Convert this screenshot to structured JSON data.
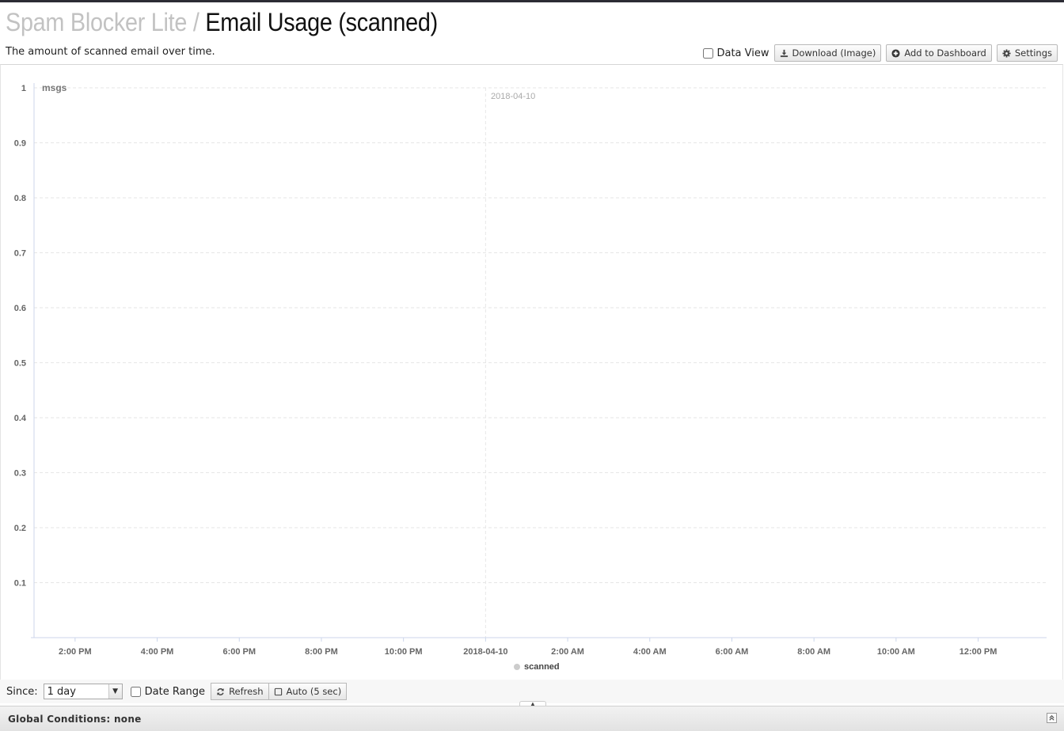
{
  "header": {
    "app_name": "Spam Blocker Lite",
    "separator": "/",
    "page_title": "Email Usage (scanned)",
    "description": "The amount of scanned email over time."
  },
  "toolbar": {
    "data_view_label": "Data View",
    "data_view_checked": false,
    "download_label": "Download (Image)",
    "add_dashboard_label": "Add to Dashboard",
    "settings_label": "Settings"
  },
  "chart_data": {
    "type": "line",
    "ylabel": "msgs",
    "ylim": [
      0,
      1
    ],
    "y_ticks": [
      {
        "value": 0.1,
        "label": "0.1"
      },
      {
        "value": 0.2,
        "label": "0.2"
      },
      {
        "value": 0.3,
        "label": "0.3"
      },
      {
        "value": 0.4,
        "label": "0.4"
      },
      {
        "value": 0.5,
        "label": "0.5"
      },
      {
        "value": 0.6,
        "label": "0.6"
      },
      {
        "value": 0.7,
        "label": "0.7"
      },
      {
        "value": 0.8,
        "label": "0.8"
      },
      {
        "value": 0.9,
        "label": "0.9"
      },
      {
        "value": 1,
        "label": "1"
      }
    ],
    "x_range": [
      "2018-04-09 13:00",
      "2018-04-10 13:40"
    ],
    "x_ticks": [
      {
        "time": "2018-04-09 14:00",
        "label": "2:00 PM"
      },
      {
        "time": "2018-04-09 16:00",
        "label": "4:00 PM"
      },
      {
        "time": "2018-04-09 18:00",
        "label": "6:00 PM"
      },
      {
        "time": "2018-04-09 20:00",
        "label": "8:00 PM"
      },
      {
        "time": "2018-04-09 22:00",
        "label": "10:00 PM"
      },
      {
        "time": "2018-04-10 00:00",
        "label": "2018-04-10"
      },
      {
        "time": "2018-04-10 02:00",
        "label": "2:00 AM"
      },
      {
        "time": "2018-04-10 04:00",
        "label": "4:00 AM"
      },
      {
        "time": "2018-04-10 06:00",
        "label": "6:00 AM"
      },
      {
        "time": "2018-04-10 08:00",
        "label": "8:00 AM"
      },
      {
        "time": "2018-04-10 10:00",
        "label": "10:00 AM"
      },
      {
        "time": "2018-04-10 12:00",
        "label": "12:00 PM"
      }
    ],
    "annotation": {
      "time": "2018-04-10 00:00",
      "label": "2018-04-10"
    },
    "grid": true,
    "legend_position": "bottom-center",
    "series": [
      {
        "name": "scanned",
        "color": "#cccccc",
        "values": []
      }
    ]
  },
  "footer": {
    "since_label": "Since:",
    "since_value": "1 day",
    "date_range_label": "Date Range",
    "refresh_label": "Refresh",
    "auto_label": "Auto (5 sec)"
  },
  "global_conditions": {
    "label": "Global Conditions: none"
  },
  "colors": {
    "grid": "#e6e6e6",
    "axis": "#ccd6eb",
    "tick_text": "#666666",
    "title_muted": "#c2c2c2"
  }
}
